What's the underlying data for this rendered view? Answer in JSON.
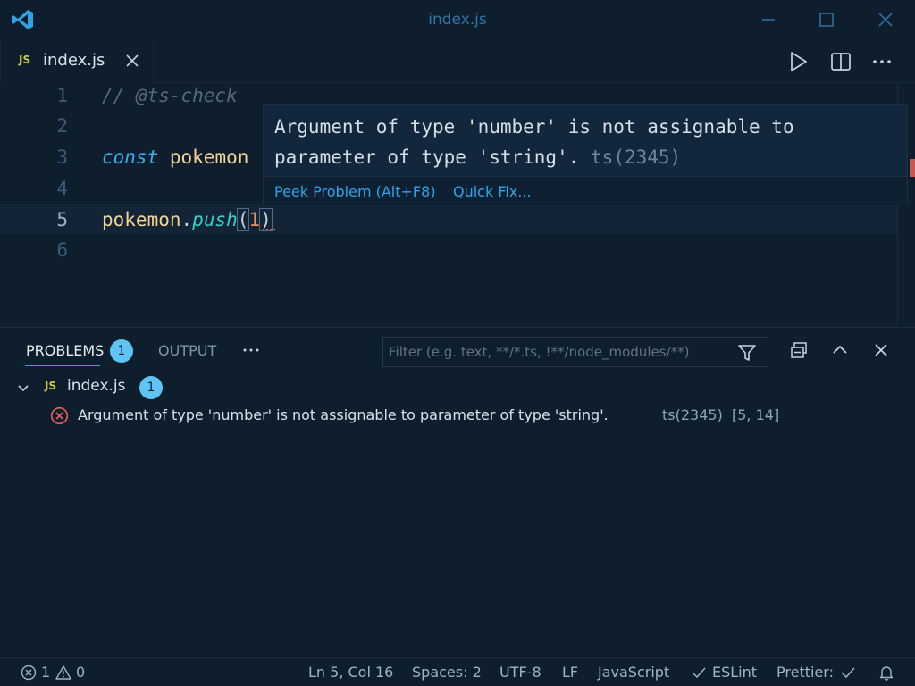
{
  "window": {
    "title": "index.js"
  },
  "tab": {
    "badge": "JS",
    "label": "index.js"
  },
  "editor": {
    "line_numbers": [
      "1",
      "2",
      "3",
      "4",
      "5",
      "6"
    ],
    "line1_comment": "// @ts-check",
    "line3_keyword": "const",
    "line3_ident": "pokemon",
    "line5_ident": "pokemon",
    "line5_dot": ".",
    "line5_method": "push",
    "line5_open": "(",
    "line5_arg": "1",
    "line5_close": ")"
  },
  "hover": {
    "message": "Argument of type 'number' is not assignable to parameter of type 'string'.",
    "code": "ts(2345)",
    "peek_label": "Peek Problem (Alt+F8)",
    "quickfix_label": "Quick Fix..."
  },
  "panel": {
    "tabs": {
      "problems": "PROBLEMS",
      "problems_count": "1",
      "output": "OUTPUT"
    },
    "filter_placeholder": "Filter (e.g. text, **/*.ts, !**/node_modules/**)",
    "file": {
      "badge": "JS",
      "name": "index.js",
      "count": "1"
    },
    "problem": {
      "message": "Argument of type 'number' is not assignable to parameter of type 'string'.",
      "code": "ts(2345)",
      "position": "[5, 14]"
    }
  },
  "statusbar": {
    "errors": "1",
    "warnings": "0",
    "cursor": "Ln 5, Col 16",
    "spaces": "Spaces: 2",
    "encoding": "UTF-8",
    "eol": "LF",
    "language": "JavaScript",
    "eslint": "ESLint",
    "prettier": "Prettier:"
  },
  "colors": {
    "accent": "#2ca5e8",
    "error": "#e8615a",
    "js_badge": "#cbcb41",
    "background": "#0f1e2d"
  },
  "icons": [
    "vscode-logo-icon",
    "minimize-icon",
    "maximize-icon",
    "close-icon",
    "run-icon",
    "split-editor-icon",
    "more-icon",
    "filter-icon",
    "collapse-all-icon",
    "chevron-up-icon",
    "chevron-down-icon",
    "error-icon",
    "warning-icon",
    "check-icon",
    "bell-icon"
  ]
}
